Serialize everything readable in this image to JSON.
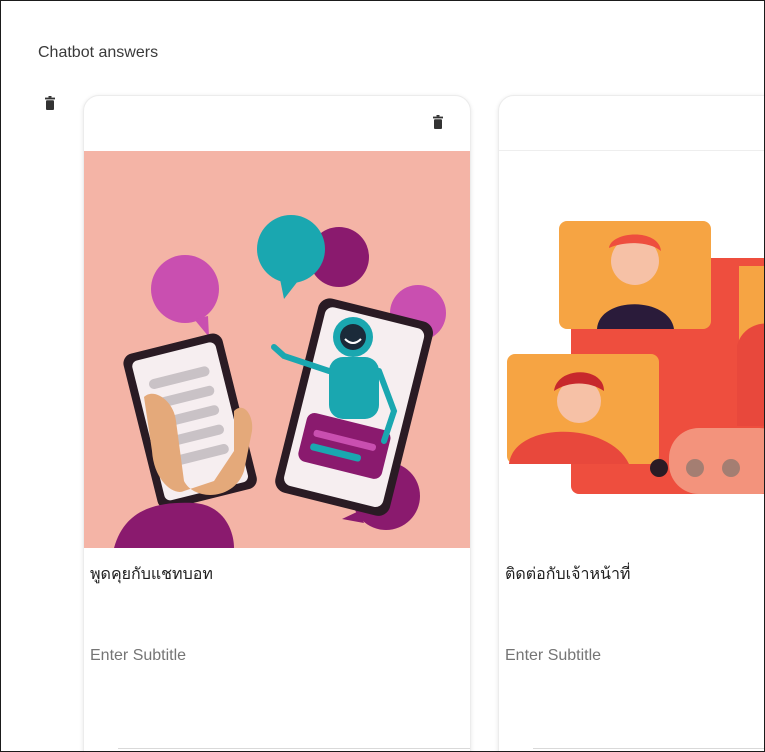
{
  "section": {
    "title": "Chatbot answers"
  },
  "cards": [
    {
      "title": "พูดคุยกับแชทบอท",
      "subtitle_placeholder": "Enter Subtitle",
      "image_icon": "chatbot-illustration"
    },
    {
      "title": "ติดต่อกับเจ้าหน้าที่",
      "subtitle_placeholder": "Enter Subtitle",
      "image_icon": "video-call-illustration"
    }
  ],
  "icons": {
    "delete": "trash-icon"
  },
  "colors": {
    "card1_bg": "#f4b4a6",
    "teal": "#1aa7b0",
    "magenta": "#c94fb0",
    "purple": "#8a1a6e",
    "coral": "#ee4e3e",
    "orange": "#f6a443"
  }
}
